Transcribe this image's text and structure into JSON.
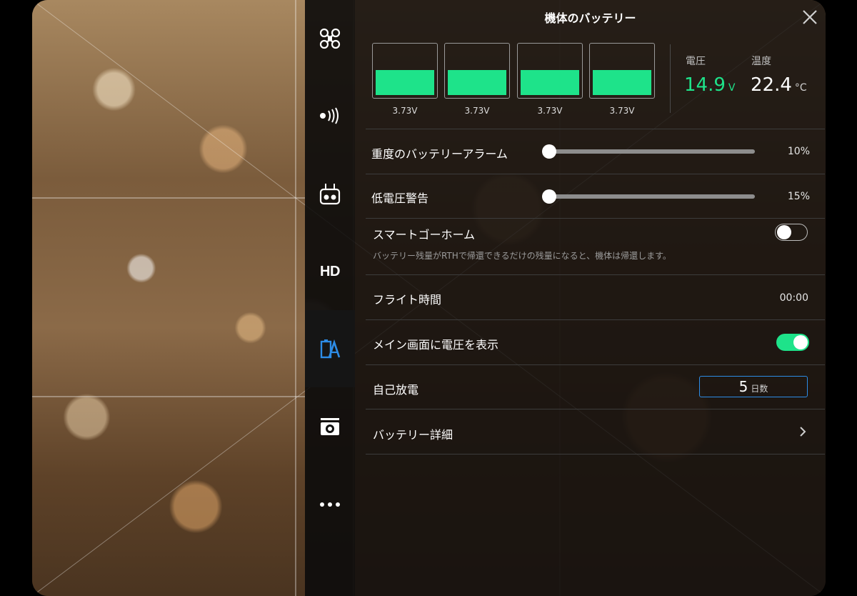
{
  "title": "機体のバッテリー",
  "sidebar": {
    "items": [
      {
        "name": "aircraft",
        "icon": "drone-icon"
      },
      {
        "name": "signal",
        "icon": "signal-icon"
      },
      {
        "name": "remote",
        "icon": "remote-controller-icon"
      },
      {
        "name": "hd",
        "label": "HD"
      },
      {
        "name": "battery",
        "icon": "battery-settings-icon",
        "active": true
      },
      {
        "name": "camera",
        "icon": "camera-icon"
      },
      {
        "name": "more",
        "icon": "more-icon"
      }
    ]
  },
  "battery": {
    "cells": [
      {
        "voltage": "3.73V",
        "level": 0.5
      },
      {
        "voltage": "3.73V",
        "level": 0.5
      },
      {
        "voltage": "3.73V",
        "level": 0.5
      },
      {
        "voltage": "3.73V",
        "level": 0.5
      }
    ],
    "voltage_label": "電圧",
    "voltage_value": "14.9",
    "voltage_unit": "V",
    "temp_label": "温度",
    "temp_value": "22.4",
    "temp_unit": "°C",
    "voltage_color": "#1ee38a"
  },
  "settings": {
    "critical_alarm": {
      "label": "重度のバッテリーアラーム",
      "value": "10%",
      "level": 0.0
    },
    "low_alarm": {
      "label": "低電圧警告",
      "value": "15%",
      "level": 0.0
    },
    "smart_rth": {
      "label": "スマートゴーホーム",
      "on": false,
      "description": "バッテリー残量がRTHで帰還できるだけの残量になると、機体は帰還します。"
    },
    "flight_time": {
      "label": "フライト時間",
      "value": "00:00"
    },
    "show_voltage": {
      "label": "メイン画面に電圧を表示",
      "on": true
    },
    "self_discharge": {
      "label": "自己放電",
      "value": "5",
      "unit": "日数"
    },
    "battery_details": {
      "label": "バッテリー詳細"
    }
  },
  "colors": {
    "accent": "#1ee38a",
    "active_icon": "#2d8ce6",
    "input_border": "#2d8ce6"
  }
}
